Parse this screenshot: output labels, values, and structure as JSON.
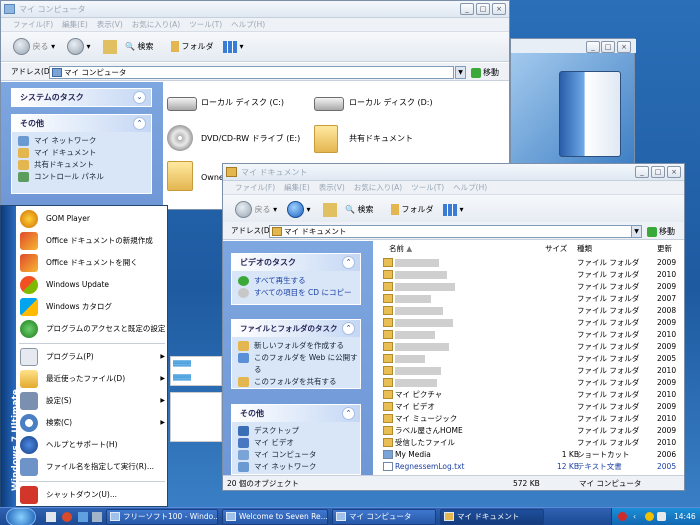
{
  "win_mycomputer": {
    "title": "マイ コンピュータ",
    "menu": [
      "ファイル(F)",
      "編集(E)",
      "表示(V)",
      "お気に入り(A)",
      "ツール(T)",
      "ヘルプ(H)"
    ],
    "toolbar": {
      "back": "戻る",
      "search": "検索",
      "folders": "フォルダ"
    },
    "address_label": "アドレス(D)",
    "address_value": "マイ コンピュータ",
    "go_label": "移動",
    "system_tasks": "システムのタスク",
    "other_places": {
      "title": "その他",
      "items": [
        "マイ ネットワーク",
        "マイ ドキュメント",
        "共有ドキュメント",
        "コントロール パネル"
      ]
    },
    "items": [
      "ローカル ディスク (C:)",
      "ローカル ディスク (D:)",
      "DVD/CD-RW ドライブ (E:)",
      "共有ドキュメント",
      "Owne"
    ]
  },
  "win_mydocs": {
    "title": "マイ ドキュメント",
    "menu": [
      "ファイル(F)",
      "編集(E)",
      "表示(V)",
      "お気に入り(A)",
      "ツール(T)",
      "ヘルプ(H)"
    ],
    "toolbar": {
      "back": "戻る",
      "search": "検索",
      "folders": "フォルダ"
    },
    "address_label": "アドレス(D)",
    "address_value": "マイ ドキュメント",
    "go_label": "移動",
    "video_tasks": {
      "title": "ビデオのタスク",
      "items": [
        "すべて再生する",
        "すべての項目を CD にコピー"
      ]
    },
    "file_tasks": {
      "title": "ファイルとフォルダのタスク",
      "items": [
        "新しいフォルダを作成する",
        "このフォルダを Web に公開する",
        "このフォルダを共有する"
      ]
    },
    "other": {
      "title": "その他",
      "items": [
        "デスクトップ",
        "マイ ビデオ",
        "マイ コンピュータ",
        "マイ ネットワーク"
      ]
    },
    "columns": {
      "name": "名前",
      "size": "サイズ",
      "type": "種類",
      "date": "更新"
    },
    "rows": [
      {
        "name": "",
        "size": "",
        "type": "ファイル フォルダ",
        "date": "2009"
      },
      {
        "name": "",
        "size": "",
        "type": "ファイル フォルダ",
        "date": "2010"
      },
      {
        "name": "",
        "size": "",
        "type": "ファイル フォルダ",
        "date": "2009"
      },
      {
        "name": "",
        "size": "",
        "type": "ファイル フォルダ",
        "date": "2007"
      },
      {
        "name": "",
        "size": "",
        "type": "ファイル フォルダ",
        "date": "2008"
      },
      {
        "name": "",
        "size": "",
        "type": "ファイル フォルダ",
        "date": "2009"
      },
      {
        "name": "",
        "size": "",
        "type": "ファイル フォルダ",
        "date": "2010"
      },
      {
        "name": "",
        "size": "",
        "type": "ファイル フォルダ",
        "date": "2009"
      },
      {
        "name": "",
        "size": "",
        "type": "ファイル フォルダ",
        "date": "2005"
      },
      {
        "name": "",
        "size": "",
        "type": "ファイル フォルダ",
        "date": "2010"
      },
      {
        "name": "",
        "size": "",
        "type": "ファイル フォルダ",
        "date": "2009"
      },
      {
        "name": "マイ ピクチャ",
        "size": "",
        "type": "ファイル フォルダ",
        "date": "2010"
      },
      {
        "name": "マイ ビデオ",
        "size": "",
        "type": "ファイル フォルダ",
        "date": "2009"
      },
      {
        "name": "マイ ミュージック",
        "size": "",
        "type": "ファイル フォルダ",
        "date": "2010"
      },
      {
        "name": "ラベル屋さんHOME",
        "size": "",
        "type": "ファイル フォルダ",
        "date": "2009"
      },
      {
        "name": "受信したファイル",
        "size": "",
        "type": "ファイル フォルダ",
        "date": "2010"
      },
      {
        "name": "My Media",
        "size": "1 KB",
        "type": "ショートカット",
        "date": "2006"
      },
      {
        "name": "RegnessemLog.txt",
        "size": "12 KB",
        "type": "テキスト文書",
        "date": "2005"
      }
    ],
    "status": {
      "count": "20 個のオブジェクト",
      "size": "572 KB",
      "location": "マイ コンピュータ"
    }
  },
  "start_menu": {
    "strip": "Windows 7 Ultimate",
    "pinned": [
      "GOM Player",
      "Office ドキュメントの新規作成",
      "Office ドキュメントを開く",
      "Windows Update",
      "Windows カタログ",
      "プログラムのアクセスと既定の設定"
    ],
    "items": [
      "プログラム(P)",
      "最近使ったファイル(D)",
      "設定(S)",
      "検索(C)",
      "ヘルプとサポート(H)",
      "ファイル名を指定して実行(R)...",
      "シャットダウン(U)..."
    ]
  },
  "taskbar": {
    "tasks": [
      "フリーソフト100 - Windo...",
      "Welcome to Seven Re...",
      "マイ コンピュータ",
      "マイ ドキュメント"
    ],
    "clock": "14:46"
  },
  "colors": {
    "accent": "#2b6bc0",
    "taskpane": "#7ea7e0",
    "link": "#1a3fa3"
  }
}
